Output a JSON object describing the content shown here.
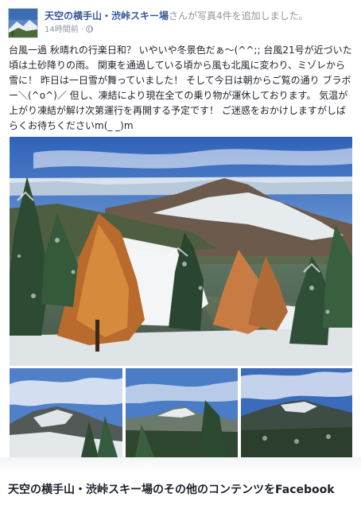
{
  "post": {
    "page_name": "天空の横手山・渋峠スキー場",
    "action_text": "さんが写真4件を追加しました。",
    "time_text": "14時間前",
    "time_separator": "·",
    "privacy_icon": "globe-icon",
    "body_text": "台風一過 秋晴れの行楽日和？ いやいや冬景色だぁ〜(^^;; 台風21号が近づいた頃は土砂降りの雨。 関東を通過している頃から風も北風に変わり、ミゾレから雪に！ 昨日は一日雪が舞っていました！ そして今日は朝からご覧の通り ブラボー＼(^o^)／ 但し、凍結により現在全ての乗り物が運休しております。 気温が上がり凍結が解け次第運行を再開する予定です！ ご迷惑をおかけしますがしばらくお待ちくださいm(_ _)m"
  },
  "footer": {
    "more_content_text": "天空の横手山・渋峠スキー場のその他のコンテンツをFacebook"
  },
  "colors": {
    "link": "#365899",
    "meta": "#90949c",
    "text": "#1d2129"
  }
}
